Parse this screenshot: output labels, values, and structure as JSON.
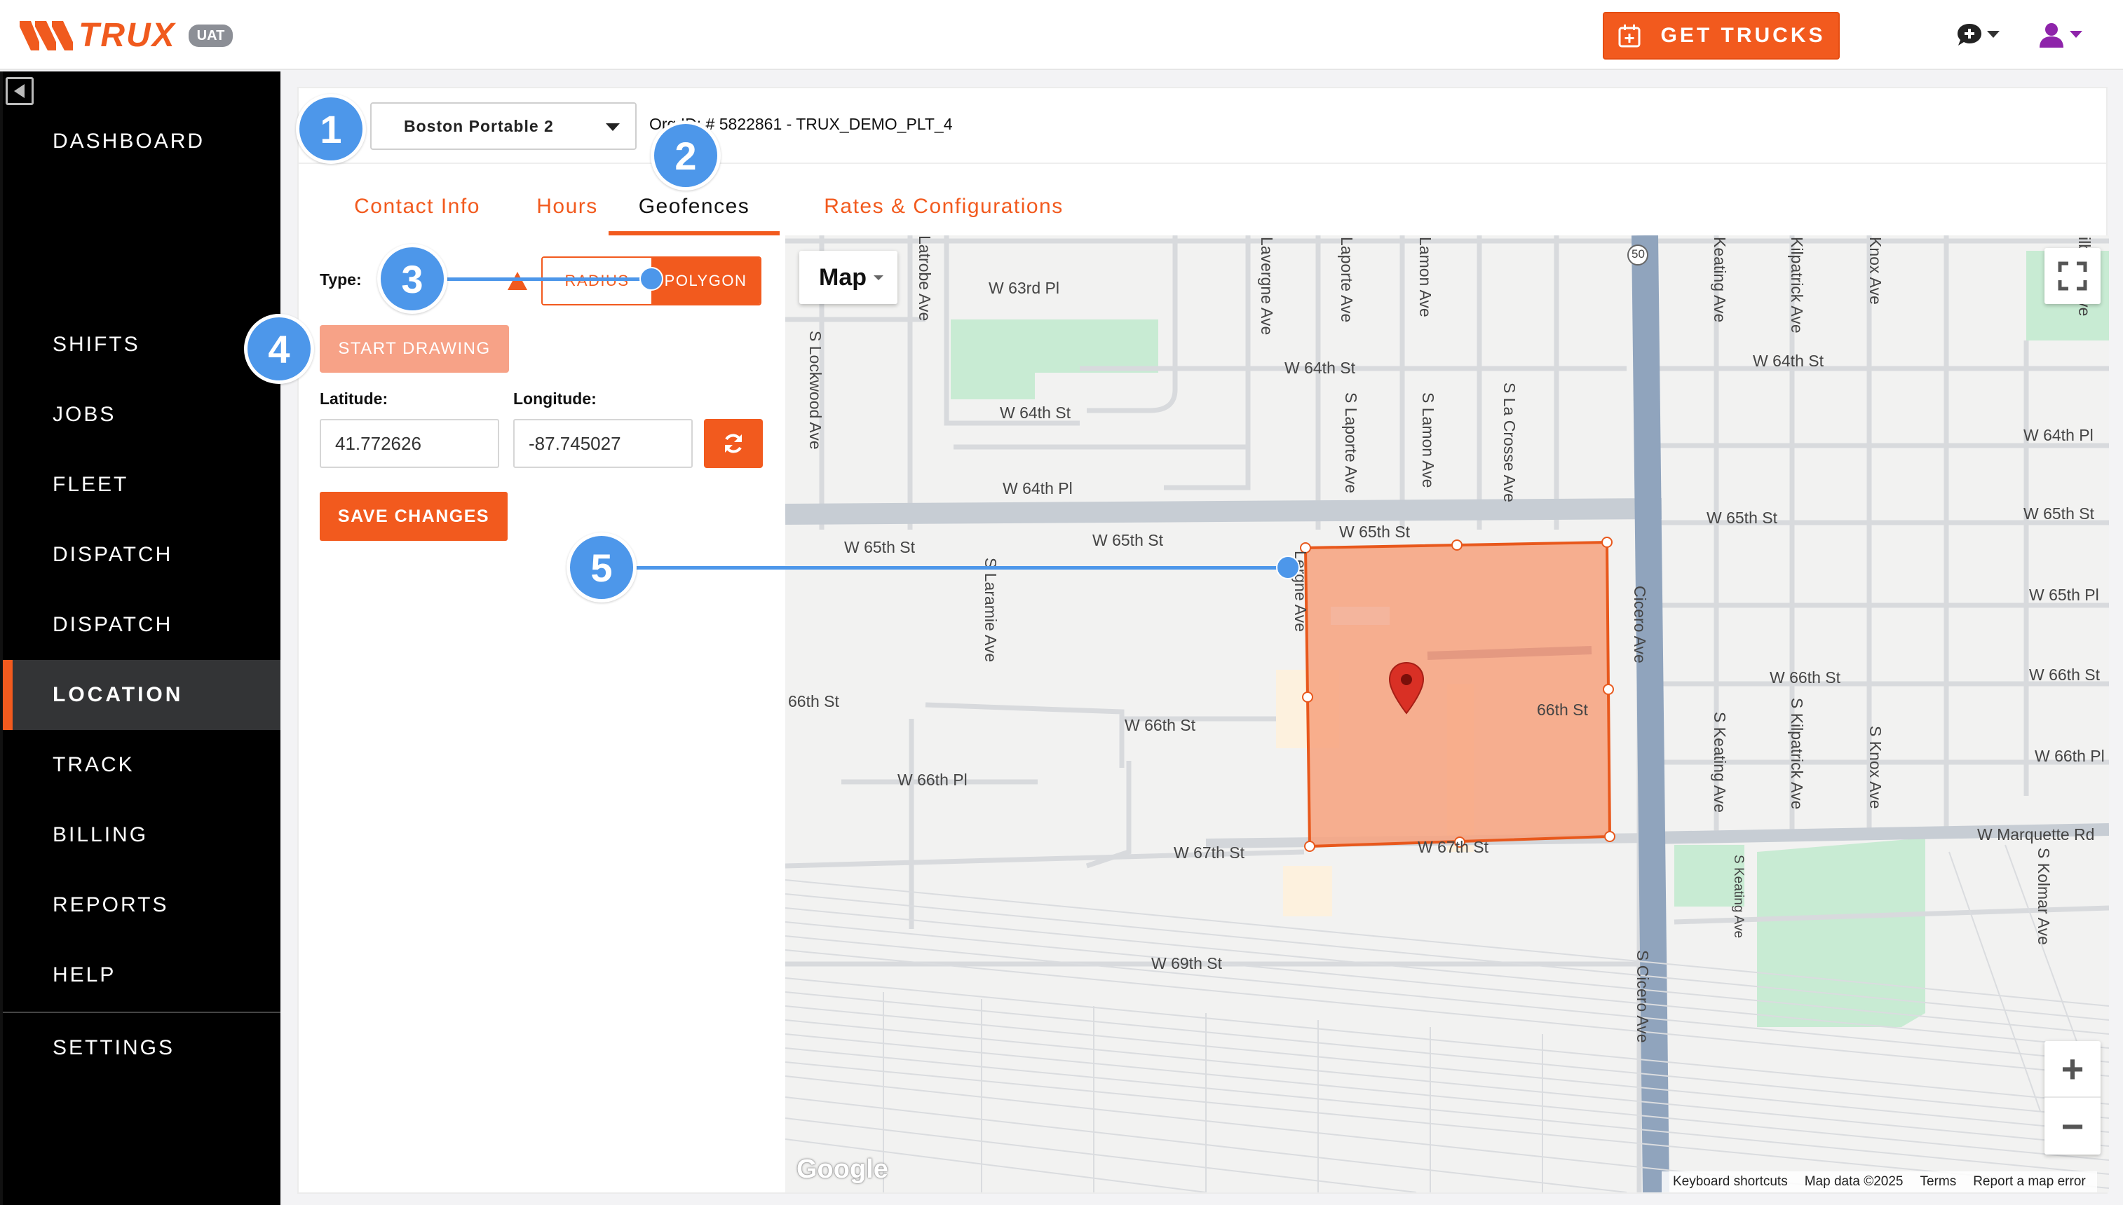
{
  "header": {
    "logo_text": "TRUX",
    "env_badge": "UAT",
    "get_trucks_label": "GET TRUCKS",
    "brand_color": "#f25a1e"
  },
  "sidebar": {
    "items": [
      {
        "label": "DASHBOARD"
      },
      {
        "label": "SHIFTS"
      },
      {
        "label": "JOBS"
      },
      {
        "label": "FLEET"
      },
      {
        "label": "DISPATCH"
      },
      {
        "label": "DISPATCH"
      },
      {
        "label": "LOCATION",
        "active": true
      },
      {
        "label": "TRACK"
      },
      {
        "label": "BILLING"
      },
      {
        "label": "REPORTS"
      },
      {
        "label": "HELP"
      },
      {
        "label": "SETTINGS"
      }
    ]
  },
  "org": {
    "selected": "Boston Portable 2",
    "id_text": "Org ID: # 5822861 - TRUX_DEMO_PLT_4"
  },
  "tabs": [
    {
      "label": "Contact Info"
    },
    {
      "label": "Hours"
    },
    {
      "label": "Geofences",
      "active": true
    },
    {
      "label": "Rates & Configurations"
    }
  ],
  "form": {
    "type_label": "Type:",
    "type_options": [
      "RADIUS",
      "POLYGON"
    ],
    "type_selected": "POLYGON",
    "start_drawing_label": "START DRAWING",
    "latitude_label": "Latitude:",
    "latitude_value": "41.772626",
    "longitude_label": "Longitude:",
    "longitude_value": "-87.745027",
    "save_label": "SAVE CHANGES"
  },
  "map": {
    "type_label": "Map",
    "zoom_in": "+",
    "zoom_out": "−",
    "google": "Google",
    "attribution": [
      "Keyboard shortcuts",
      "Map data ©2025",
      "Terms",
      "Report a map error"
    ],
    "route_shield": "50",
    "streets": {
      "w63rd_pl": "W 63rd Pl",
      "w64th_st_a": "W 64th St",
      "w64th_st_b": "W 64th St",
      "w64th_st_c": "W 64th St",
      "w64th_pl_a": "W 64th Pl",
      "w64th_pl_b": "W 64th Pl",
      "w65th_st_a": "W 65th St",
      "w65th_st_b": "W 65th St",
      "w65th_st_c": "W 65th St",
      "w65th_st_d": "W 65th St",
      "w65th_st_e": "W 65th St",
      "w65th_pl": "W 65th Pl",
      "w66th_st_a": "66th St",
      "w66th_st_b": "W 66th St",
      "w66th_st_c": "66th St",
      "w66th_st_d": "W 66th St",
      "w66th_st_e": "W 66th St",
      "w66th_pl_a": "W 66th Pl",
      "w66th_pl_b": "W 66th Pl",
      "w67th_st_a": "W 67th St",
      "w67th_st_b": "W 67th St",
      "w69th_st": "W 69th St",
      "marquette": "W Marquette Rd",
      "latrobe": "Latrobe Ave",
      "lockwood": "S Lockwood Ave",
      "lavergne": "Lavergne Ave",
      "laporte": "Laporte Ave",
      "lamon": "Lamon Ave",
      "s_laporte": "S Laporte Ave",
      "s_lamon": "S Lamon Ave",
      "s_lacrosse": "S La Crosse Ave",
      "s_laramie": "S Laramie Ave",
      "lergne": "Lergne Ave",
      "cicero": "Cicero Ave",
      "s_cicero": "S Cicero Ave",
      "keating": "Keating Ave",
      "kilpatrick": "Kilpatrick Ave",
      "knox": "Knox Ave",
      "s_keating": "S Keating Ave",
      "s_keating2": "S Keating Ave",
      "s_kilpatrick": "S Kilpatrick Ave",
      "s_knox": "S Knox Ave",
      "s_kolmar": "S Kolmar Ave",
      "kilbourn": "ilbourn Ave"
    },
    "geofence_fill": "#f7a27e",
    "geofence_stroke": "#e8581c",
    "marker_color": "#d93025"
  },
  "callouts": [
    "1",
    "2",
    "3",
    "4",
    "5"
  ]
}
